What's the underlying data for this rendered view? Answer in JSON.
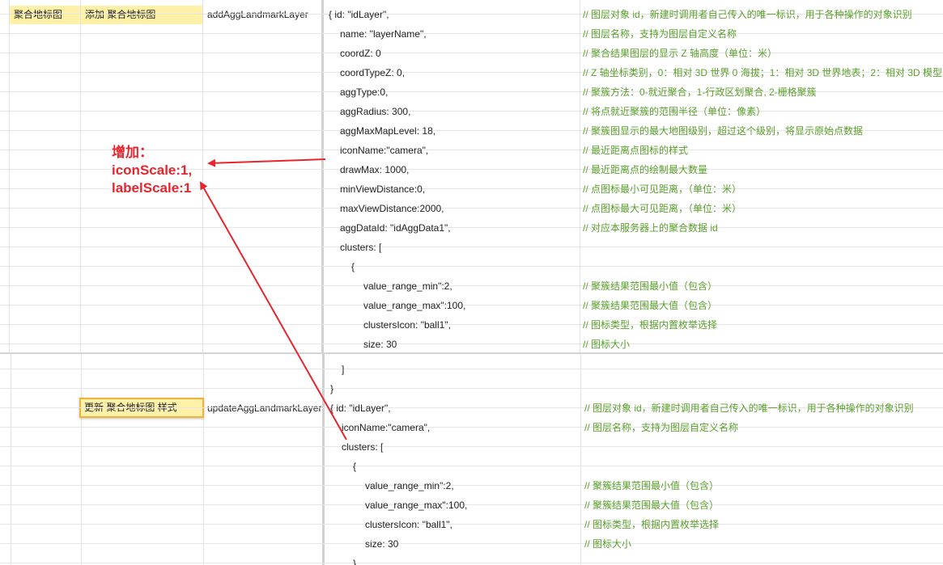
{
  "sheet_top": {
    "category": "聚合地标图",
    "action": "添加 聚合地标图",
    "method": "addAggLandmarkLayer",
    "rows": [
      {
        "code": "{   id: \"idLayer\",",
        "comment": "// 图层对象 id，新建时调用者自己传入的唯一标识，用于各种操作的对象识别"
      },
      {
        "code": "name: \"layerName\",",
        "comment": "// 图层名称，支持为图层自定义名称"
      },
      {
        "code": "coordZ: 0",
        "comment": "// 聚合结果图层的显示 Z 轴高度（单位：米）"
      },
      {
        "code": "coordTypeZ: 0,",
        "comment": "// Z 轴坐标类别，0：相对 3D 世界 0 海拔；1：相对 3D 世界地表；2：相对 3D 模型"
      },
      {
        "code": "aggType:0,",
        "comment": "// 聚簇方法：0-就近聚合，1-行政区划聚合, 2-栅格聚簇"
      },
      {
        "code": "aggRadius: 300,",
        "comment": "// 将点就近聚簇的范围半径（单位：像素）"
      },
      {
        "code": "aggMaxMapLevel: 18,",
        "comment": "// 聚簇图显示的最大地图级别，超过这个级别，将显示原始点数据"
      },
      {
        "code": "iconName:\"camera\",",
        "comment": "// 最近距离点图标的样式"
      },
      {
        "code": "drawMax: 1000,",
        "comment": "// 最近距离点的绘制最大数量"
      },
      {
        "code": "minViewDistance:0,",
        "comment": "// 点图标最小可见距离，（单位：米）"
      },
      {
        "code": "maxViewDistance:2000,",
        "comment": "// 点图标最大可见距离，（单位：米）"
      },
      {
        "code": "aggDataId: \"idAggData1\",",
        "comment": "// 对应本服务器上的聚合数据 id"
      },
      {
        "code": "clusters: [",
        "comment": ""
      },
      {
        "code": "{",
        "comment": ""
      },
      {
        "code": "value_range_min\":2,",
        "comment": "// 聚簇结果范围最小值（包含）"
      },
      {
        "code": "value_range_max\":100,",
        "comment": "// 聚簇结果范围最大值（包含）"
      },
      {
        "code": "clustersIcon: \"ball1\",",
        "comment": "// 图标类型，根据内置枚举选择"
      },
      {
        "code": "size: 30",
        "comment": "// 图标大小"
      }
    ]
  },
  "sheet_bottom": {
    "action": "更新 聚合地标图 样式",
    "method": "updateAggLandmarkLayer",
    "rows": [
      {
        "code": "]",
        "comment": ""
      },
      {
        "code": "}",
        "comment": ""
      },
      {
        "code": "{   id: \"idLayer\",",
        "comment": "// 图层对象 id，新建时调用者自己传入的唯一标识，用于各种操作的对象识别"
      },
      {
        "code": "iconName:\"camera\",",
        "comment": "// 图层名称，支持为图层自定义名称"
      },
      {
        "code": "clusters: [",
        "comment": ""
      },
      {
        "code": "{",
        "comment": ""
      },
      {
        "code": "value_range_min\":2,",
        "comment": "// 聚簇结果范围最小值（包含）"
      },
      {
        "code": "value_range_max\":100,",
        "comment": "// 聚簇结果范围最大值（包含）"
      },
      {
        "code": "clustersIcon: \"ball1\",",
        "comment": "// 图标类型，根据内置枚举选择"
      },
      {
        "code": "size: 30",
        "comment": "// 图标大小"
      },
      {
        "code": "}",
        "comment": ""
      }
    ]
  },
  "annotation": {
    "line1": "增加：",
    "line2": "iconScale:1,",
    "line3": "labelScale:1",
    "color": "#e5262e"
  },
  "colors": {
    "highlight": "#fff2a8",
    "selected_border": "#f0b23a",
    "comment": "#5aa02c"
  }
}
